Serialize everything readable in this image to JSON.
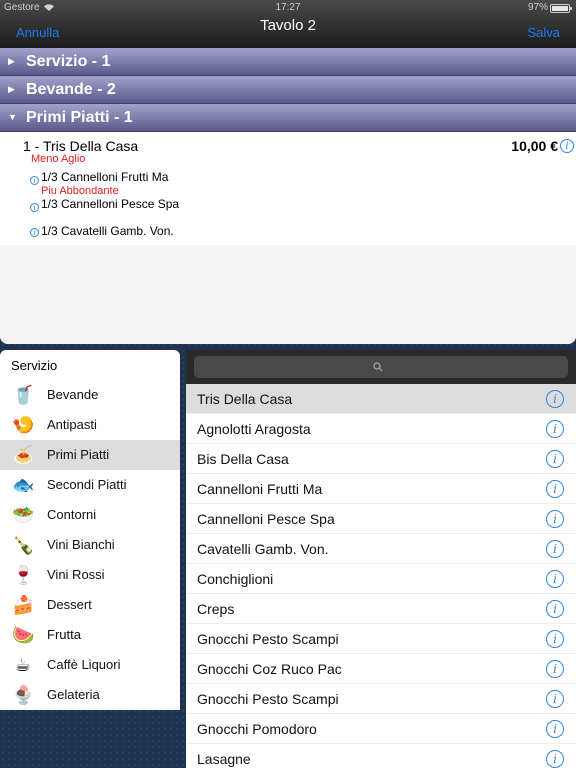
{
  "status_bar": {
    "carrier": "Gestore",
    "time": "17:27",
    "battery": "97%",
    "battery_level": 0.97
  },
  "nav": {
    "left_button": "Annulla",
    "title": "Tavolo 2",
    "right_button": "Salva"
  },
  "order": {
    "sections": [
      {
        "label": "Servizio - 1",
        "expanded": false
      },
      {
        "label": "Bevande - 2",
        "expanded": false
      },
      {
        "label": "Primi Piatti - 1",
        "expanded": true
      }
    ],
    "item": {
      "qty_name": "1 - Tris Della Casa",
      "price": "10,00 €",
      "note": "Meno  Aglio",
      "components": [
        {
          "name": "1/3 Cannelloni Frutti Ma",
          "note": "Piu  Abbondante"
        },
        {
          "name": "1/3 Cannelloni Pesce Spa"
        },
        {
          "name": "1/3 Cavatelli Gamb. Von."
        }
      ]
    }
  },
  "categories": {
    "header": "Servizio",
    "items": [
      {
        "label": "Bevande",
        "icon": "soda-can-icon",
        "glyph": "🥤"
      },
      {
        "label": "Antipasti",
        "icon": "appetizer-plate-icon",
        "glyph": "🍤"
      },
      {
        "label": "Primi Piatti",
        "icon": "pasta-plate-icon",
        "glyph": "🍝"
      },
      {
        "label": "Secondi Piatti",
        "icon": "fish-icon",
        "glyph": "🐟"
      },
      {
        "label": "Contorni",
        "icon": "salad-icon",
        "glyph": "🥗"
      },
      {
        "label": "Vini Bianchi",
        "icon": "white-wine-icon",
        "glyph": "🍾"
      },
      {
        "label": "Vini Rossi",
        "icon": "red-wine-icon",
        "glyph": "🍷"
      },
      {
        "label": "Dessert",
        "icon": "cake-slice-icon",
        "glyph": "🍰"
      },
      {
        "label": "Frutta",
        "icon": "watermelon-icon",
        "glyph": "🍉"
      },
      {
        "label": "Caffè Liquori",
        "icon": "coffee-cup-icon",
        "glyph": "☕"
      },
      {
        "label": "Gelateria",
        "icon": "ice-cream-icon",
        "glyph": "🍨"
      }
    ],
    "selected": "Primi Piatti"
  },
  "products": {
    "search_placeholder": "",
    "items": [
      "Tris Della Casa",
      "Agnolotti Aragosta",
      "Bis Della Casa",
      "Cannelloni Frutti Ma",
      "Cannelloni Pesce Spa",
      "Cavatelli Gamb. Von.",
      "Conchiglioni",
      "Creps",
      "Gnocchi Pesto Scampi",
      "Gnocchi Coz Ruco Pac",
      "Gnocchi Pesto Scampi",
      "Gnocchi Pomodoro",
      "Lasagne"
    ],
    "selected": "Tris Della Casa"
  },
  "colors": {
    "accent": "#1a7df0",
    "section_bar": "#6a6a9c",
    "note_red": "#e02020",
    "selected_row": "#dcdcdc"
  }
}
